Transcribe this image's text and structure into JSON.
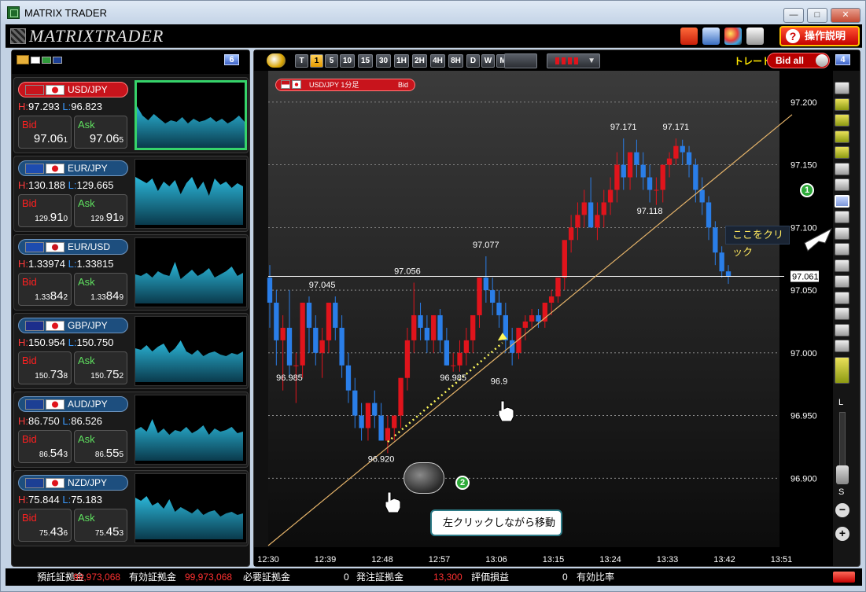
{
  "window": {
    "title": "MATRIX TRADER",
    "minimize": "—",
    "maximize": "□",
    "close": "✕"
  },
  "toolbar": {
    "logo": "MATRIXTRADER",
    "help_label": "操作説明",
    "help_icon": "?"
  },
  "watchlist": {
    "count_badge": "6",
    "items": [
      {
        "pair": "USD/JPY",
        "high": "97.293",
        "low": "96.823",
        "bid_label": "Bid",
        "ask_label": "Ask",
        "bid_main": "97.06",
        "bid_pip": "1",
        "ask_main": "97.06",
        "ask_pip": "5",
        "bid_prefix": "",
        "ask_prefix": "",
        "active": true
      },
      {
        "pair": "EUR/JPY",
        "high": "130.188",
        "low": "129.665",
        "bid_label": "Bid",
        "ask_label": "Ask",
        "bid_prefix": "129.",
        "bid_main": "91",
        "bid_pip": "0",
        "ask_prefix": "129.",
        "ask_main": "91",
        "ask_pip": "9",
        "active": false
      },
      {
        "pair": "EUR/USD",
        "high": "1.33974",
        "low": "1.33815",
        "bid_label": "Bid",
        "ask_label": "Ask",
        "bid_prefix": "1.33",
        "bid_main": "84",
        "bid_pip": "2",
        "ask_prefix": "1.33",
        "ask_main": "84",
        "ask_pip": "9",
        "active": false
      },
      {
        "pair": "GBP/JPY",
        "high": "150.954",
        "low": "150.750",
        "bid_label": "Bid",
        "ask_label": "Ask",
        "bid_prefix": "150.",
        "bid_main": "73",
        "bid_pip": "8",
        "ask_prefix": "150.",
        "ask_main": "75",
        "ask_pip": "2",
        "active": false
      },
      {
        "pair": "AUD/JPY",
        "high": "86.750",
        "low": "86.526",
        "bid_label": "Bid",
        "ask_label": "Ask",
        "bid_prefix": "86.",
        "bid_main": "54",
        "bid_pip": "3",
        "ask_prefix": "86.",
        "ask_main": "55",
        "ask_pip": "5",
        "active": false
      },
      {
        "pair": "NZD/JPY",
        "high": "75.844",
        "low": "75.183",
        "bid_label": "Bid",
        "ask_label": "Ask",
        "bid_prefix": "75.",
        "bid_main": "43",
        "bid_pip": "6",
        "ask_prefix": "75.",
        "ask_main": "45",
        "ask_pip": "3",
        "active": false
      }
    ]
  },
  "chart_header": {
    "timeframes": [
      "T",
      "1",
      "5",
      "10",
      "15",
      "30",
      "1H",
      "2H",
      "4H",
      "8H",
      "D",
      "W",
      "M"
    ],
    "selected_timeframe": "1",
    "trade_label": "トレード",
    "bid_all_label": "Bid all",
    "window_badge": "4"
  },
  "chart_symbol": {
    "label": "USD/JPY 1分足",
    "side": "Bid"
  },
  "chart_data": {
    "type": "candlestick",
    "title": "USD/JPY 1分足",
    "x_ticks": [
      "12:30",
      "12:39",
      "12:48",
      "12:57",
      "13:06",
      "13:15",
      "13:24",
      "13:33",
      "13:42",
      "13:51"
    ],
    "y_ticks": [
      "97.200",
      "97.150",
      "97.100",
      "97.050",
      "97.000",
      "96.950",
      "96.900"
    ],
    "ylim": [
      96.845,
      97.225
    ],
    "current_price": "97.061",
    "annotations": [
      "97.045",
      "96.985",
      "97.056",
      "96.985",
      "97.077",
      "96.9",
      "96.920",
      "97.171",
      "97.171",
      "97.118"
    ],
    "candles_ohlc": [
      [
        97.06,
        97.07,
        97.02,
        97.04
      ],
      [
        97.04,
        97.05,
        96.99,
        97.01
      ],
      [
        97.01,
        97.03,
        96.97,
        97.02
      ],
      [
        97.02,
        97.05,
        96.98,
        96.99
      ],
      [
        96.99,
        97.0,
        96.96,
        96.99
      ],
      [
        96.99,
        97.04,
        96.98,
        97.04
      ],
      [
        97.04,
        97.045,
        97.0,
        97.02
      ],
      [
        97.02,
        97.03,
        96.99,
        97.0
      ],
      [
        97.0,
        97.02,
        96.98,
        97.01
      ],
      [
        97.01,
        97.04,
        97.0,
        97.04
      ],
      [
        97.04,
        97.045,
        97.01,
        97.02
      ],
      [
        97.02,
        97.03,
        96.98,
        96.99
      ],
      [
        96.99,
        97.0,
        96.96,
        96.97
      ],
      [
        96.97,
        96.98,
        96.94,
        96.95
      ],
      [
        96.95,
        96.96,
        96.93,
        96.94
      ],
      [
        96.94,
        96.96,
        96.93,
        96.96
      ],
      [
        96.96,
        96.97,
        96.94,
        96.95
      ],
      [
        96.95,
        96.96,
        96.93,
        96.93
      ],
      [
        96.93,
        96.95,
        96.92,
        96.94
      ],
      [
        96.94,
        96.95,
        96.93,
        96.95
      ],
      [
        96.95,
        96.98,
        96.94,
        96.98
      ],
      [
        96.98,
        97.02,
        96.97,
        97.01
      ],
      [
        97.01,
        97.056,
        97.0,
        97.03
      ],
      [
        97.03,
        97.04,
        97.01,
        97.02
      ],
      [
        97.02,
        97.03,
        97.0,
        97.01
      ],
      [
        97.01,
        97.03,
        97.0,
        97.03
      ],
      [
        97.03,
        97.035,
        97.0,
        97.01
      ],
      [
        97.01,
        97.02,
        96.99,
        96.99
      ],
      [
        96.99,
        97.0,
        96.985,
        96.99
      ],
      [
        96.99,
        97.01,
        96.985,
        97.0
      ],
      [
        97.0,
        97.02,
        96.99,
        97.01
      ],
      [
        97.01,
        97.03,
        97.0,
        97.03
      ],
      [
        97.03,
        97.06,
        97.02,
        97.06
      ],
      [
        97.06,
        97.077,
        97.04,
        97.05
      ],
      [
        97.05,
        97.06,
        97.03,
        97.04
      ],
      [
        97.04,
        97.05,
        97.02,
        97.03
      ],
      [
        97.03,
        97.04,
        97.0,
        97.01
      ],
      [
        97.01,
        97.02,
        96.99,
        97.0
      ],
      [
        97.0,
        97.02,
        96.995,
        97.02
      ],
      [
        97.02,
        97.03,
        97.01,
        97.025
      ],
      [
        97.025,
        97.035,
        97.02,
        97.03
      ],
      [
        97.03,
        97.035,
        97.02,
        97.025
      ],
      [
        97.025,
        97.04,
        97.02,
        97.04
      ],
      [
        97.04,
        97.05,
        97.03,
        97.045
      ],
      [
        97.045,
        97.06,
        97.04,
        97.06
      ],
      [
        97.06,
        97.09,
        97.05,
        97.09
      ],
      [
        97.09,
        97.11,
        97.08,
        97.1
      ],
      [
        97.1,
        97.12,
        97.09,
        97.11
      ],
      [
        97.11,
        97.13,
        97.1,
        97.12
      ],
      [
        97.12,
        97.14,
        97.1,
        97.1
      ],
      [
        97.1,
        97.12,
        97.09,
        97.11
      ],
      [
        97.11,
        97.13,
        97.1,
        97.12
      ],
      [
        97.12,
        97.14,
        97.11,
        97.13
      ],
      [
        97.13,
        97.16,
        97.12,
        97.15
      ],
      [
        97.15,
        97.171,
        97.13,
        97.14
      ],
      [
        97.14,
        97.16,
        97.13,
        97.16
      ],
      [
        97.16,
        97.17,
        97.14,
        97.15
      ],
      [
        97.15,
        97.16,
        97.13,
        97.14
      ],
      [
        97.14,
        97.15,
        97.12,
        97.13
      ],
      [
        97.13,
        97.14,
        97.118,
        97.13
      ],
      [
        97.13,
        97.15,
        97.12,
        97.15
      ],
      [
        97.15,
        97.16,
        97.14,
        97.155
      ],
      [
        97.155,
        97.171,
        97.15,
        97.165
      ],
      [
        97.165,
        97.17,
        97.15,
        97.16
      ],
      [
        97.16,
        97.165,
        97.14,
        97.15
      ],
      [
        97.15,
        97.155,
        97.12,
        97.13
      ],
      [
        97.13,
        97.14,
        97.11,
        97.12
      ],
      [
        97.12,
        97.125,
        97.09,
        97.1
      ],
      [
        97.1,
        97.105,
        97.07,
        97.08
      ],
      [
        97.08,
        97.085,
        97.06,
        97.065
      ],
      [
        97.065,
        97.07,
        97.055,
        97.061
      ]
    ]
  },
  "callouts": {
    "step1_num": "1",
    "step1_text": "ここをクリック",
    "step2_num": "2",
    "step2_text": "左クリックしながら移動"
  },
  "zoom": {
    "large": "L",
    "small": "S",
    "minus": "−",
    "plus": "+"
  },
  "status": {
    "deposit_label": "預託証拠金",
    "deposit_value": "99,973,068",
    "effective_label": "有効証拠金",
    "effective_value": "99,973,068",
    "required_label": "必要証拠金",
    "required_value": "0",
    "order_label": "発注証拠金",
    "order_value": "13,300",
    "pnl_label": "評価損益",
    "pnl_value": "0",
    "ratio_label": "有効比率"
  },
  "colors": {
    "up": "#e0141c",
    "down": "#2a7ee8",
    "accent": "#c8141c",
    "trendline": "#e6b46a"
  }
}
